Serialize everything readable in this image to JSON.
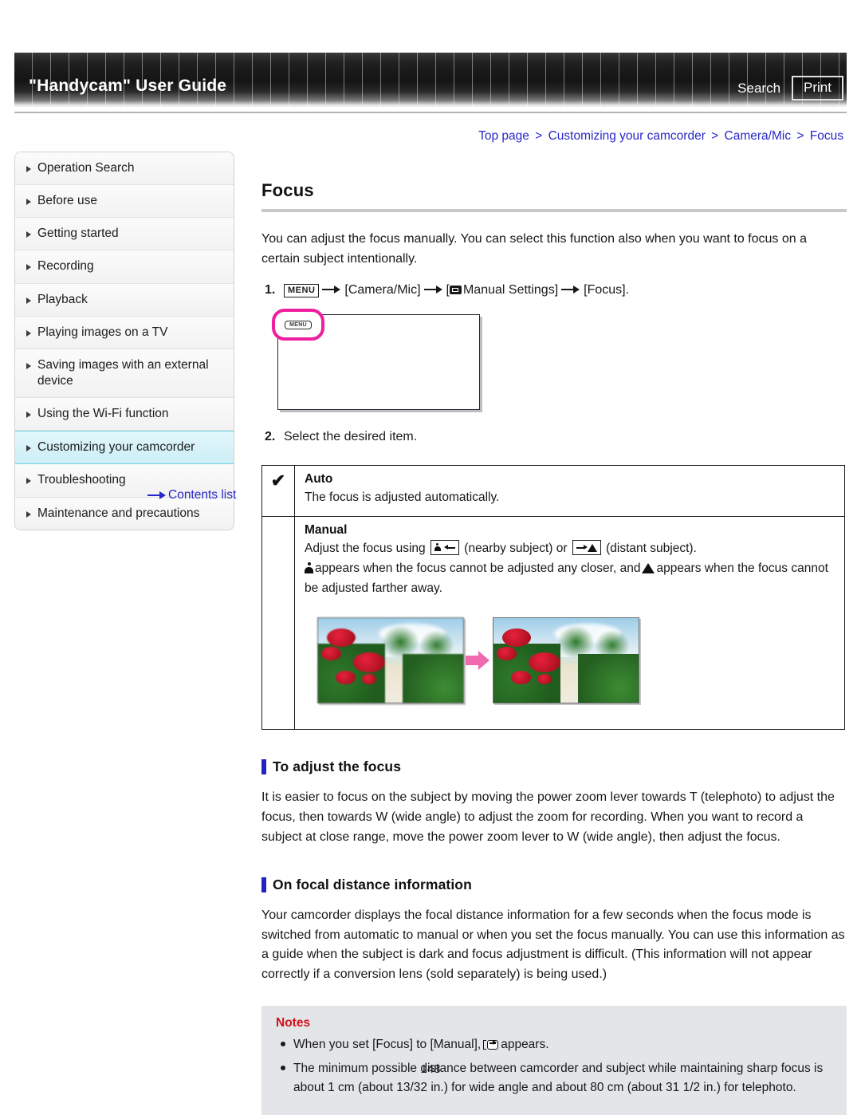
{
  "header": {
    "title": "\"Handycam\" User Guide",
    "search_label": "Search",
    "print_label": "Print"
  },
  "breadcrumb": {
    "items": [
      "Top page",
      "Customizing your camcorder",
      "Camera/Mic",
      "Focus"
    ],
    "separator": ">"
  },
  "sidebar": {
    "items": [
      {
        "label": "Operation Search",
        "active": false
      },
      {
        "label": "Before use",
        "active": false
      },
      {
        "label": "Getting started",
        "active": false
      },
      {
        "label": "Recording",
        "active": false
      },
      {
        "label": "Playback",
        "active": false
      },
      {
        "label": "Playing images on a TV",
        "active": false
      },
      {
        "label": "Saving images with an external device",
        "active": false
      },
      {
        "label": "Using the Wi-Fi function",
        "active": false
      },
      {
        "label": "Customizing your camcorder",
        "active": true
      },
      {
        "label": "Troubleshooting",
        "active": false
      },
      {
        "label": "Maintenance and precautions",
        "active": false
      }
    ],
    "contents_link": "Contents list"
  },
  "main": {
    "page_title": "Focus",
    "intro": "You can adjust the focus manually. You can select this function also when you want to focus on a certain subject intentionally.",
    "step1": {
      "number": "1.",
      "menu_chip": "MENU",
      "part_a": "[Camera/Mic]",
      "part_b_prefix": "[",
      "part_b": "Manual Settings]",
      "part_c": "[Focus]."
    },
    "step2": {
      "number": "2.",
      "text": "Select the desired item."
    },
    "screen_illustration": {
      "menu_button_label": "MENU",
      "callout_color": "#ef1e9e"
    },
    "options_table": [
      {
        "checked": true,
        "check_glyph": "✔",
        "name": "Auto",
        "desc": "The focus is adjusted automatically."
      },
      {
        "checked": false,
        "check_glyph": "",
        "name": "Manual",
        "desc_line1_a": "Adjust the focus using",
        "desc_line1_b": "(nearby subject) or",
        "desc_line1_c": "(distant subject).",
        "desc_line2_a": "appears when the focus cannot be adjusted any closer, and",
        "desc_line2_b": "appears when the focus cannot be adjusted farther away."
      }
    ],
    "sections": [
      {
        "heading": "To adjust the focus",
        "body": "It is easier to focus on the subject by moving the power zoom lever towards T (telephoto) to adjust the focus, then towards W (wide angle) to adjust the zoom for recording. When you want to record a subject at close range, move the power zoom lever to W (wide angle), then adjust the focus."
      },
      {
        "heading": "On focal distance information",
        "body": "Your camcorder displays the focal distance information for a few seconds when the focus mode is switched from automatic to manual or when you set the focus manually. You can use this information as a guide when the subject is dark and focus adjustment is difficult. (This information will not appear correctly if a conversion lens (sold separately) is being used.)"
      }
    ],
    "notes": {
      "title": "Notes",
      "items": [
        {
          "prefix": "When you set [Focus] to [Manual],",
          "suffix": "appears.",
          "has_icon": true
        },
        {
          "prefix": "The minimum possible distance between camcorder and subject while maintaining sharp focus is about 1 cm (about 13/32 in.) for wide angle and about 80 cm (about 31 1/2 in.) for telephoto.",
          "suffix": "",
          "has_icon": false
        }
      ]
    }
  },
  "footer": {
    "page_number": "148"
  },
  "colors": {
    "link": "#2828c8",
    "accent_bar": "#2222c4",
    "notes_title": "#d3101b",
    "notes_bg": "#e3e5e8",
    "sidebar_active_bg": "#cdeef6",
    "callout_pink": "#ef1e9e"
  }
}
